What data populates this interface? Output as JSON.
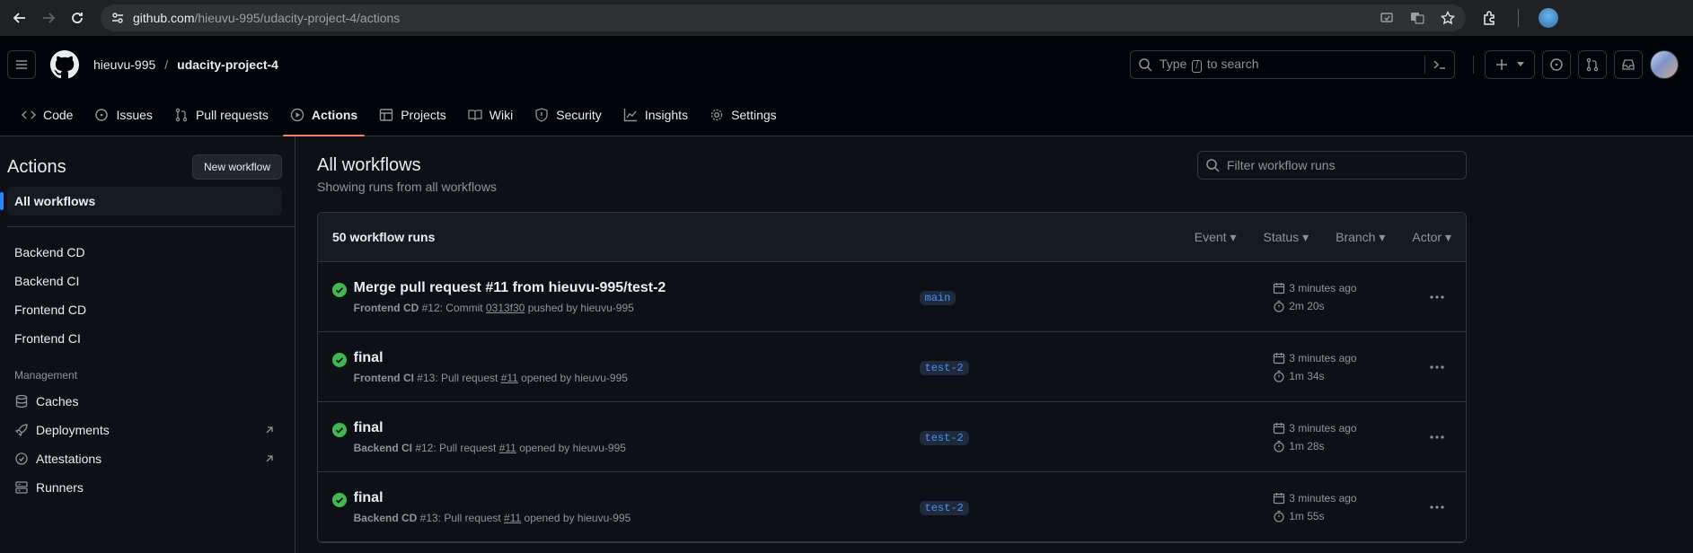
{
  "browser": {
    "url_host": "github.com",
    "url_path": "/hieuvu-995/udacity-project-4/actions"
  },
  "header": {
    "owner": "hieuvu-995",
    "separator": "/",
    "repo": "udacity-project-4",
    "search": {
      "before": "Type",
      "key": "/",
      "after": "to search"
    }
  },
  "tabs": [
    {
      "label": "Code",
      "icon": "code-icon"
    },
    {
      "label": "Issues",
      "icon": "issue-icon"
    },
    {
      "label": "Pull requests",
      "icon": "pull-request-icon"
    },
    {
      "label": "Actions",
      "icon": "play-icon",
      "active": true
    },
    {
      "label": "Projects",
      "icon": "table-icon"
    },
    {
      "label": "Wiki",
      "icon": "book-icon"
    },
    {
      "label": "Security",
      "icon": "shield-icon"
    },
    {
      "label": "Insights",
      "icon": "graph-icon"
    },
    {
      "label": "Settings",
      "icon": "gear-icon"
    }
  ],
  "sidebar": {
    "title": "Actions",
    "new_workflow": "New workflow",
    "all_workflows": "All workflows",
    "workflows": [
      "Backend CD",
      "Backend CI",
      "Frontend CD",
      "Frontend CI"
    ],
    "management_label": "Management",
    "management": [
      {
        "label": "Caches",
        "icon": "database-icon"
      },
      {
        "label": "Deployments",
        "icon": "rocket-icon",
        "external": true
      },
      {
        "label": "Attestations",
        "icon": "verified-icon",
        "external": true
      },
      {
        "label": "Runners",
        "icon": "server-icon"
      }
    ]
  },
  "main": {
    "title": "All workflows",
    "subtitle": "Showing runs from all workflows",
    "filter_placeholder": "Filter workflow runs",
    "runs_count": "50 workflow runs",
    "filters": [
      "Event",
      "Status",
      "Branch",
      "Actor"
    ],
    "runs": [
      {
        "title": "Merge pull request #11 from hieuvu-995/test-2",
        "workflow": "Frontend CD",
        "meta_mid": " #12: Commit ",
        "ref": "0313f30",
        "meta_end": " pushed by hieuvu-995",
        "branch": "main",
        "when": "3 minutes ago",
        "duration": "2m 20s"
      },
      {
        "title": "final",
        "workflow": "Frontend CI",
        "meta_mid": " #13: Pull request ",
        "ref": "#11",
        "meta_end": " opened by hieuvu-995",
        "branch": "test-2",
        "when": "3 minutes ago",
        "duration": "1m 34s"
      },
      {
        "title": "final",
        "workflow": "Backend CI",
        "meta_mid": " #12: Pull request ",
        "ref": "#11",
        "meta_end": " opened by hieuvu-995",
        "branch": "test-2",
        "when": "3 minutes ago",
        "duration": "1m 28s"
      },
      {
        "title": "final",
        "workflow": "Backend CD",
        "meta_mid": " #13: Pull request ",
        "ref": "#11",
        "meta_end": " opened by hieuvu-995",
        "branch": "test-2",
        "when": "3 minutes ago",
        "duration": "1m 55s"
      }
    ]
  },
  "colors": {
    "success": "#3fb950",
    "accent": "#2f81f7",
    "tab_underline": "#f78166"
  }
}
